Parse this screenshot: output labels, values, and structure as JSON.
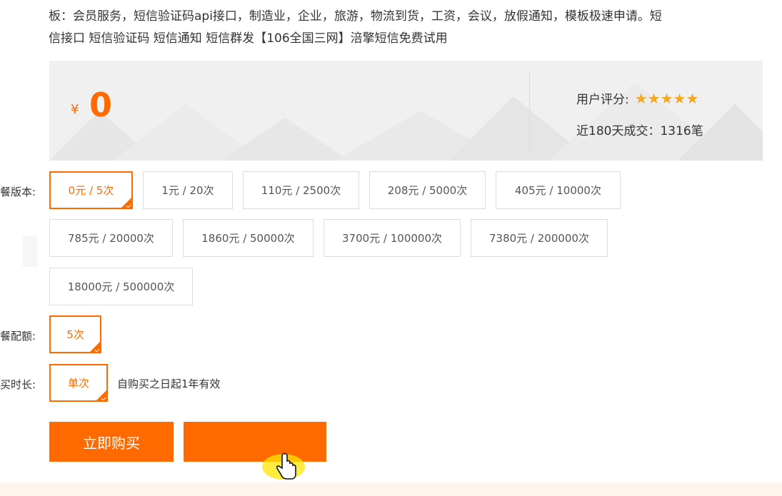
{
  "description": {
    "line1": "板：会员服务，短信验证码api接口，制造业，企业，旅游，物流到货，工资，会议，放假通知，模板极速申请。短",
    "line2": "信接口 短信验证码 短信通知 短信群发【106全国三网】涪擎短信免费试用"
  },
  "price": {
    "currency": "¥",
    "value": "0"
  },
  "rating": {
    "label": "用户评分:",
    "stars": 5,
    "star_glyph": "★",
    "star_color": "#f5a623"
  },
  "deals": {
    "text": "近180天成交：1316笔"
  },
  "package_version": {
    "label": "餐版本:",
    "options": [
      "0元 / 5次",
      "1元 / 20次",
      "110元 / 2500次",
      "208元 / 5000次",
      "405元 / 10000次",
      "785元 / 20000次",
      "1860元 / 50000次",
      "3700元 / 100000次",
      "7380元 / 200000次",
      "18000元 / 500000次"
    ],
    "selected": "0元 / 5次"
  },
  "package_quota": {
    "label": "餐配额:",
    "options": [
      "5次"
    ],
    "selected": "5次"
  },
  "purchase_duration": {
    "label": "买时长:",
    "options": [
      "单次"
    ],
    "selected": "单次",
    "note": "自购买之日起1年有效"
  },
  "buttons": {
    "buy_now": "立即购买",
    "secondary": ""
  },
  "colors": {
    "accent": "#ff6a00"
  }
}
